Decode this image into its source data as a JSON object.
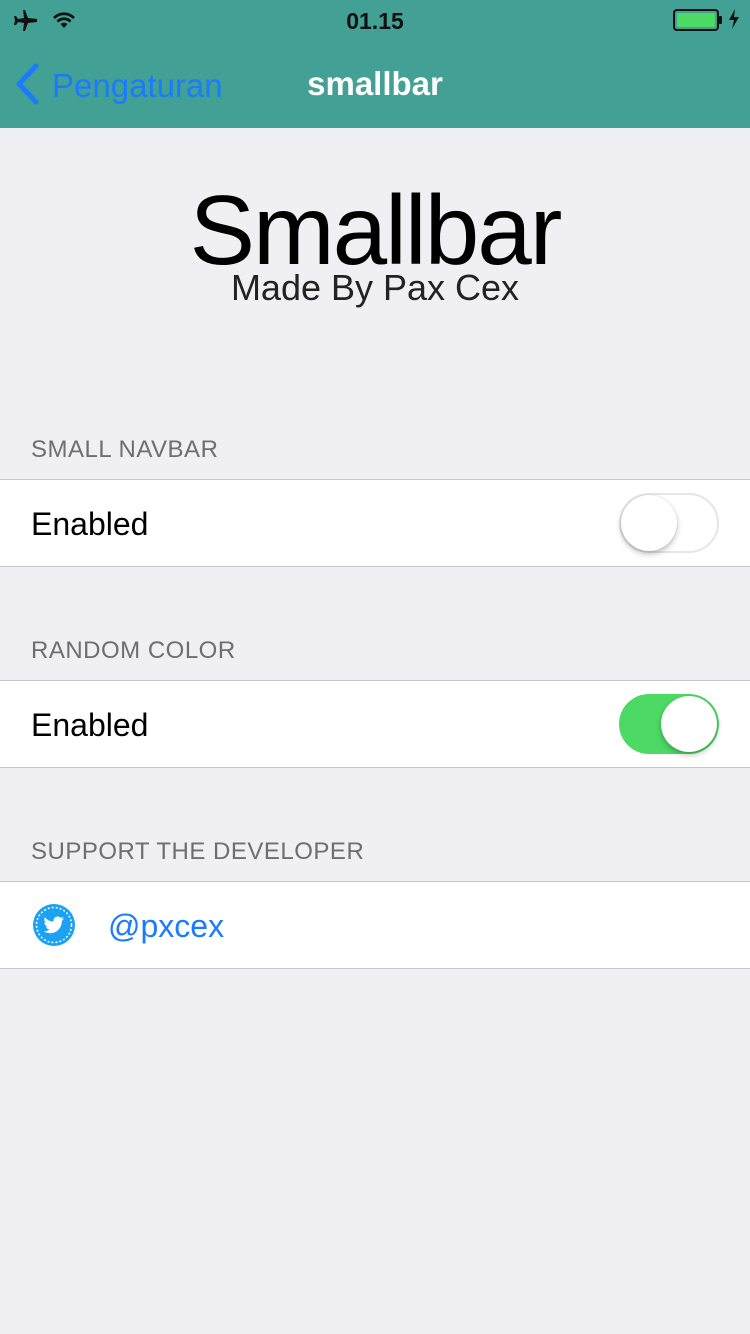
{
  "status_bar": {
    "time": "01.15"
  },
  "navbar": {
    "back_label": "Pengaturan",
    "title": "smallbar"
  },
  "hero": {
    "title": "Smallbar",
    "subtitle": "Made By Pax Cex"
  },
  "sections": [
    {
      "header": "SMALL NAVBAR",
      "row_label": "Enabled",
      "toggle_on": false
    },
    {
      "header": "RANDOM COLOR",
      "row_label": "Enabled",
      "toggle_on": true
    },
    {
      "header": "SUPPORT THE DEVELOPER",
      "row_label": "@pxcex",
      "icon": "twitter-icon"
    }
  ],
  "colors": {
    "navbar_bg": "#42a094",
    "accent_blue": "#1a7bff",
    "switch_on": "#4cd964",
    "battery_fill": "#4cd964",
    "twitter_blue": "#1da1f2",
    "background": "#efeff4"
  }
}
